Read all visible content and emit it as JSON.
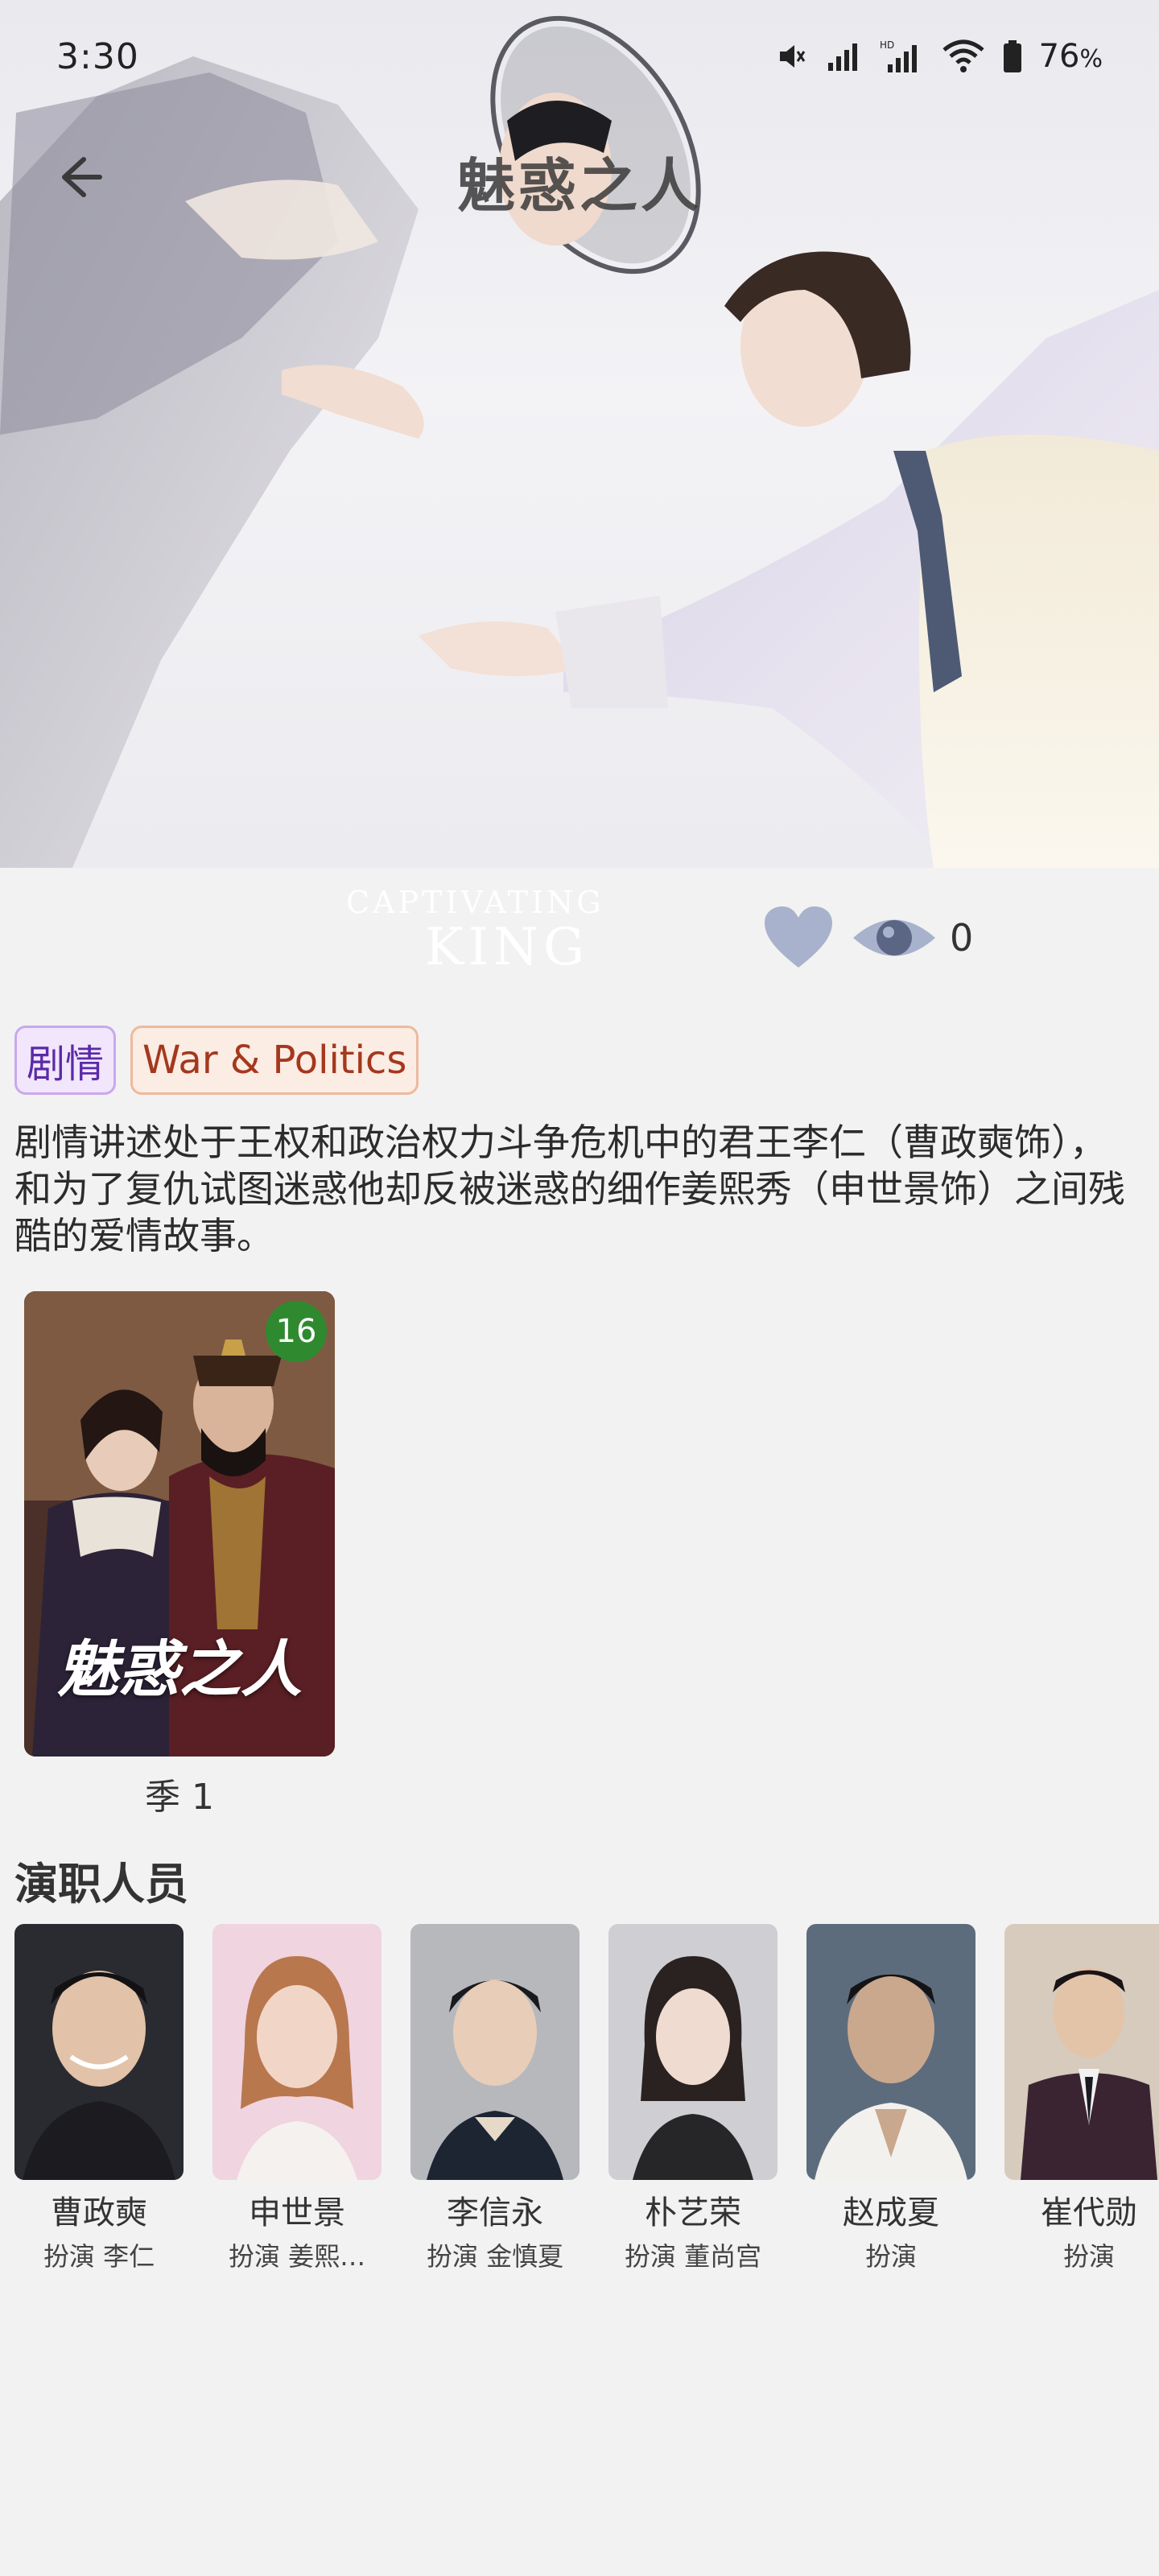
{
  "status_bar": {
    "time": "3:30",
    "battery": "76",
    "battery_unit": "%",
    "icons": [
      "mute-icon",
      "signal-icon",
      "hd-signal-icon",
      "wifi-icon",
      "battery-icon"
    ]
  },
  "header": {
    "title": "魅惑之人",
    "back_icon": "back-arrow-icon"
  },
  "hero": {
    "logo_line1": "CAPTIVATING",
    "logo_line2": "KING"
  },
  "actions": {
    "favorite_icon": "heart-icon",
    "views_icon": "eye-icon",
    "view_count": "0"
  },
  "tags": [
    {
      "label": "剧情"
    },
    {
      "label": "War & Politics"
    }
  ],
  "description": "剧情讲述处于王权和政治权力斗争危机中的君王李仁（曹政奭饰），和为了复仇试图迷惑他却反被迷惑的细作姜熙秀（申世景饰）之间残酷的爱情故事。",
  "seasons": [
    {
      "label": "季 1",
      "episodes": "16",
      "poster_title": "魅惑之人"
    }
  ],
  "cast": {
    "heading": "演职人员",
    "members": [
      {
        "name": "曹政奭",
        "role": "扮演 李仁"
      },
      {
        "name": "申世景",
        "role": "扮演 姜熙…"
      },
      {
        "name": "李信永",
        "role": "扮演 金慎夏"
      },
      {
        "name": "朴艺荣",
        "role": "扮演 董尚宫"
      },
      {
        "name": "赵成夏",
        "role": "扮演"
      },
      {
        "name": "崔代勋",
        "role": "扮演"
      }
    ]
  },
  "colors": {
    "accent_heart": "#a9b2cc",
    "episode_badge": "#2f8a2f",
    "tag_genre_text": "#5a2aa8",
    "tag_war_text": "#a4381d"
  }
}
